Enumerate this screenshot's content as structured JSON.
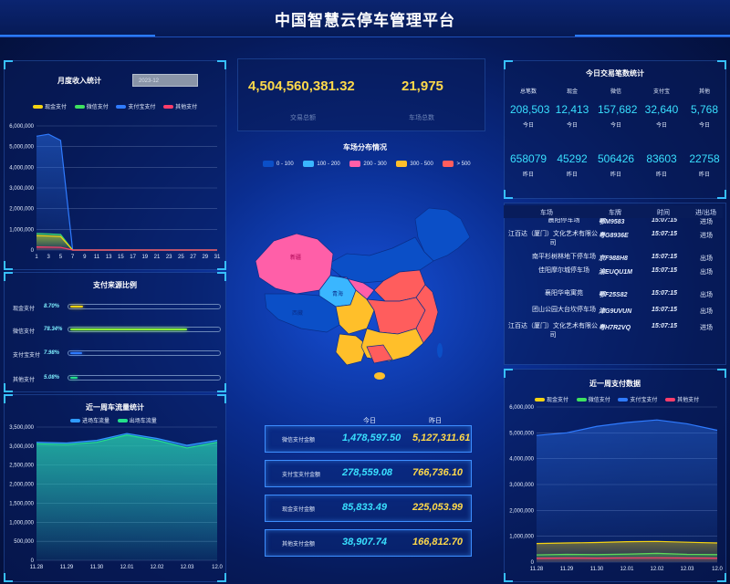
{
  "header": {
    "title": "中国智慧云停车管理平台"
  },
  "monthly_income": {
    "title": "月度收入统计",
    "month_select": "2023-12",
    "legend": [
      {
        "name": "现金支付",
        "color": "#f5d312"
      },
      {
        "name": "微信支付",
        "color": "#3ee25f"
      },
      {
        "name": "支付宝支付",
        "color": "#2f7bff"
      },
      {
        "name": "其他支付",
        "color": "#ff3d6a"
      }
    ]
  },
  "payment_source": {
    "title": "支付来源比例",
    "rows": [
      {
        "label": "现金支付",
        "pct": "8.70%",
        "value": 8.7,
        "color": "#f5d312"
      },
      {
        "label": "微信支付",
        "pct": "78.34%",
        "value": 78.34,
        "color": "#8cff3a"
      },
      {
        "label": "支付宝支付",
        "pct": "7.98%",
        "value": 7.98,
        "color": "#2f7bff"
      },
      {
        "label": "其他支付",
        "pct": "5.08%",
        "value": 5.08,
        "color": "#23e08a"
      }
    ]
  },
  "weekly_traffic": {
    "title": "近一周车流量统计",
    "legend": [
      {
        "name": "进场车流量",
        "color": "#2f9bff"
      },
      {
        "name": "出场车流量",
        "color": "#23e08a"
      }
    ]
  },
  "totals": {
    "amount": "4,504,560,381.32",
    "amount_label": "交易总额",
    "lots": "21,975",
    "lots_label": "车场总数"
  },
  "map": {
    "title": "车场分布情况",
    "legend": [
      {
        "label": "0 - 100",
        "color": "#0b4fc7"
      },
      {
        "label": "100 - 200",
        "color": "#3ab6ff"
      },
      {
        "label": "200 - 300",
        "color": "#ff5fa8"
      },
      {
        "label": "300 - 500",
        "color": "#ffbf2a"
      },
      {
        "label": "> 500",
        "color": "#ff5d5d"
      }
    ],
    "region_labels": [
      "新疆",
      "西藏",
      "青海"
    ]
  },
  "compare": {
    "today_header": "今日",
    "yesterday_header": "昨日",
    "rows": [
      {
        "label": "微信支付金额",
        "today": "1,478,597.50",
        "yesterday": "5,127,311.61"
      },
      {
        "label": "支付宝支付金额",
        "today": "278,559.08",
        "yesterday": "766,736.10"
      },
      {
        "label": "现金支付金额",
        "today": "85,833.49",
        "yesterday": "225,053.99"
      },
      {
        "label": "其他支付金额",
        "today": "38,907.74",
        "yesterday": "166,812.70"
      }
    ]
  },
  "today_trades": {
    "title": "今日交易笔数统计",
    "columns": [
      {
        "header": "总笔数",
        "today": "208,503",
        "yesterday": "658079"
      },
      {
        "header": "现金",
        "today": "12,413",
        "yesterday": "45292"
      },
      {
        "header": "微信",
        "today": "157,682",
        "yesterday": "506426"
      },
      {
        "header": "支付宝",
        "today": "32,640",
        "yesterday": "83603"
      },
      {
        "header": "其他",
        "today": "5,768",
        "yesterday": "22758"
      }
    ],
    "today_label": "今日",
    "yesterday_label": "昨日"
  },
  "records": {
    "headers": [
      "车场",
      "车牌",
      "时间",
      "进/出场"
    ],
    "rows": [
      {
        "lot": "晨阳停车场",
        "plate": "鄂M9583",
        "time": "15:07:15",
        "dir": "进场"
      },
      {
        "lot": "江百达（厦门）文化艺术有限公司",
        "plate": "粤G8936E",
        "time": "15:07:15",
        "dir": "进场"
      },
      {
        "lot": "南平杉树林地下停车场",
        "plate": "京F988H8",
        "time": "15:07:15",
        "dir": "出场"
      },
      {
        "lot": "佳阳摩尔城停车场",
        "plate": "渝EUQU1M",
        "time": "15:07:15",
        "dir": "出场"
      },
      {
        "lot": "襄阳华电寓苑",
        "plate": "鄂F25S82",
        "time": "15:07:15",
        "dir": "出场"
      },
      {
        "lot": "团山公园大台坎停车场",
        "plate": "津G9UVUN",
        "time": "15:07:15",
        "dir": "出场"
      },
      {
        "lot": "江百达（厦门）文化艺术有限公司",
        "plate": "粤H7R2VQ",
        "time": "15:07:15",
        "dir": "进场"
      }
    ]
  },
  "weekly_pay": {
    "title": "近一周支付数据",
    "legend": [
      {
        "name": "现金支付",
        "color": "#f5d312"
      },
      {
        "name": "微信支付",
        "color": "#3ee25f"
      },
      {
        "name": "支付宝支付",
        "color": "#2f7bff"
      },
      {
        "name": "其他支付",
        "color": "#ff3d6a"
      }
    ]
  },
  "chart_data": [
    {
      "type": "area",
      "x": [
        1,
        3,
        5,
        7,
        9,
        11,
        13,
        15,
        17,
        19,
        21,
        23,
        25,
        27,
        29,
        31
      ],
      "xticks": [
        "1",
        "3",
        "5",
        "7",
        "9",
        "11",
        "13",
        "15",
        "17",
        "19",
        "21",
        "23",
        "25",
        "27",
        "29",
        "31"
      ],
      "ylim": [
        0,
        6000000
      ],
      "yticks": [
        "0",
        "1,000,000",
        "2,000,000",
        "3,000,000",
        "4,000,000",
        "5,000,000",
        "6,000,000"
      ],
      "series": [
        {
          "name": "现金支付",
          "values": [
            800000,
            780000,
            750000,
            0,
            0,
            0,
            0,
            0,
            0,
            0,
            0,
            0,
            0,
            0,
            0,
            0
          ]
        },
        {
          "name": "微信支付",
          "values": [
            5500000,
            5600000,
            5300000,
            0,
            0,
            0,
            0,
            0,
            0,
            0,
            0,
            0,
            0,
            0,
            0,
            0
          ]
        },
        {
          "name": "支付宝支付",
          "values": [
            700000,
            680000,
            650000,
            0,
            0,
            0,
            0,
            0,
            0,
            0,
            0,
            0,
            0,
            0,
            0,
            0
          ]
        },
        {
          "name": "其他支付",
          "values": [
            150000,
            140000,
            130000,
            0,
            0,
            0,
            0,
            0,
            0,
            0,
            0,
            0,
            0,
            0,
            0,
            0
          ]
        }
      ]
    },
    {
      "type": "area",
      "categories": [
        "11.28",
        "11.29",
        "11.30",
        "12.01",
        "12.02",
        "12.03",
        "12.0"
      ],
      "ylim": [
        0,
        3500000
      ],
      "yticks": [
        "0",
        "500,000",
        "1,000,000",
        "1,500,000",
        "2,000,000",
        "2,500,000",
        "3,000,000",
        "3,500,000"
      ],
      "series": [
        {
          "name": "进场车流量",
          "values": [
            3100000,
            3080000,
            3150000,
            3330000,
            3200000,
            3020000,
            3150000
          ]
        },
        {
          "name": "出场车流量",
          "values": [
            3060000,
            3040000,
            3100000,
            3290000,
            3150000,
            2950000,
            3100000
          ]
        }
      ]
    },
    {
      "type": "area",
      "categories": [
        "11.28",
        "11.29",
        "11.30",
        "12.01",
        "12.02",
        "12.03",
        "12.0"
      ],
      "ylim": [
        0,
        6000000
      ],
      "yticks": [
        "0",
        "1,000,000",
        "2,000,000",
        "3,000,000",
        "4,000,000",
        "5,000,000",
        "6,000,000"
      ],
      "series": [
        {
          "name": "现金支付",
          "values": [
            280000,
            300000,
            290000,
            310000,
            340000,
            300000,
            290000
          ]
        },
        {
          "name": "微信支付",
          "values": [
            4900000,
            5000000,
            5250000,
            5400000,
            5500000,
            5350000,
            5100000
          ]
        },
        {
          "name": "支付宝支付",
          "values": [
            720000,
            740000,
            760000,
            790000,
            800000,
            770000,
            740000
          ]
        },
        {
          "name": "其他支付",
          "values": [
            150000,
            160000,
            155000,
            165000,
            170000,
            160000,
            155000
          ]
        }
      ]
    }
  ]
}
